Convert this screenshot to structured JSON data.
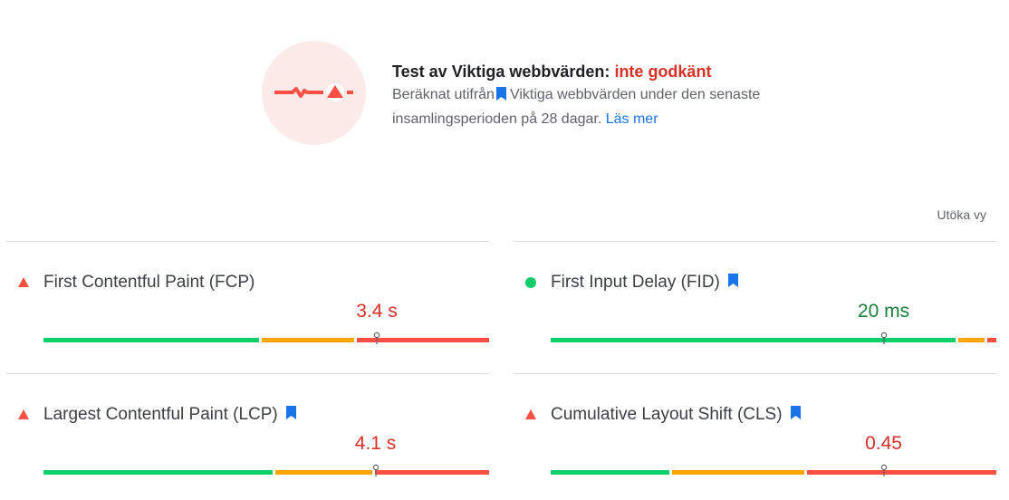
{
  "assessment": {
    "title_prefix": "Test av Viktiga webbvärden:",
    "title_status": "inte godkänt",
    "desc_before": "Beräknat utifrån",
    "desc_after": "Viktiga webbvärden under den senaste insamlingsperioden på 28 dagar.",
    "learn_more": "Läs mer",
    "status_color": "#d93025"
  },
  "expand_view": "Utöka vy",
  "metrics": [
    {
      "label": "First Contentful Paint (FCP)",
      "value": "3.4 s",
      "status": "poor",
      "bookmark": false,
      "distribution": {
        "good": 0.49,
        "needs_improvement": 0.21,
        "poor": 0.3
      },
      "marker_position": 0.748
    },
    {
      "label": "First Input Delay (FID)",
      "value": "20 ms",
      "status": "good",
      "bookmark": true,
      "distribution": {
        "good": 0.92,
        "needs_improvement": 0.06,
        "poor": 0.02
      },
      "marker_position": 0.747
    },
    {
      "label": "Largest Contentful Paint (LCP)",
      "value": "4.1 s",
      "status": "poor",
      "bookmark": true,
      "distribution": {
        "good": 0.52,
        "needs_improvement": 0.22,
        "poor": 0.26
      },
      "marker_position": 0.745
    },
    {
      "label": "Cumulative Layout Shift (CLS)",
      "value": "0.45",
      "status": "poor",
      "bookmark": true,
      "distribution": {
        "good": 0.27,
        "needs_improvement": 0.3,
        "poor": 0.43
      },
      "marker_position": 0.747
    }
  ],
  "colors": {
    "good": "#0cce6b",
    "needs_improvement": "#ffa400",
    "poor": "#ff4e42",
    "bookmark": "#1a73e8"
  },
  "icons": {
    "assessment": "failed-assessment-icon",
    "poor": "red-triangle-icon",
    "good": "green-circle-icon",
    "bookmark": "bookmark-icon",
    "marker": "pin-marker-icon"
  }
}
